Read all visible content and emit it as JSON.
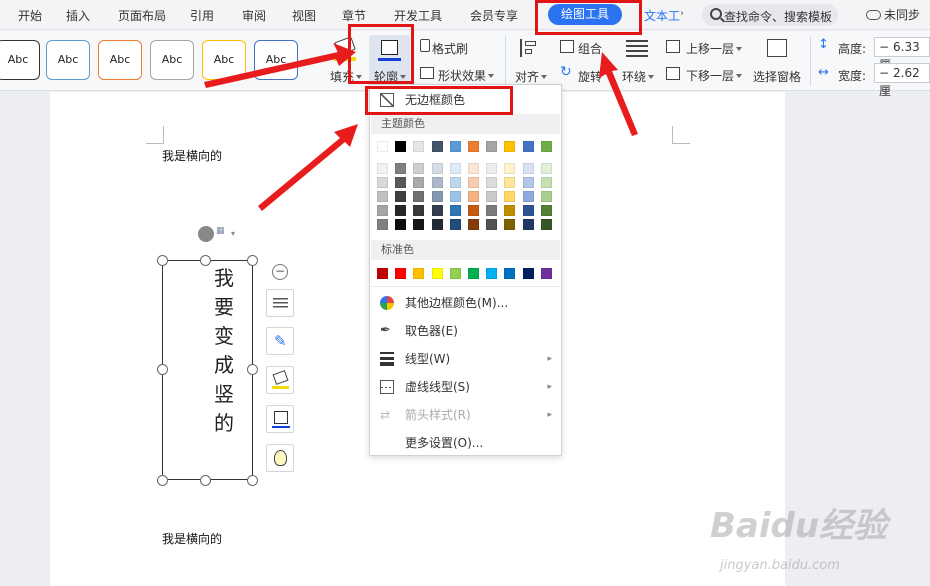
{
  "tabs": [
    "开始",
    "插入",
    "页面布局",
    "引用",
    "审阅",
    "视图",
    "章节",
    "开发工具",
    "会员专享"
  ],
  "active_tab": "绘图工具",
  "text_tool_tab": "文本工",
  "search_placeholder": "查找命令、搜索模板",
  "sync_label": "未同步",
  "styles": [
    "Abc",
    "Abc",
    "Abc",
    "Abc",
    "Abc",
    "Abc"
  ],
  "style_colors": [
    "#333333",
    "#5b9bd5",
    "#ed7d31",
    "#a5a5a5",
    "#ffc000",
    "#4472c4"
  ],
  "ribbon": {
    "fill": "填充",
    "outline": "轮廓",
    "format_brush": "格式刷",
    "shape_effect": "形状效果",
    "align": "对齐",
    "group": "组合",
    "rotate": "旋转",
    "wrap": "环绕",
    "bring_forward": "上移一层",
    "send_backward": "下移一层",
    "select_pane": "选择窗格",
    "height_label": "高度:",
    "height_value": "6.33厘",
    "width_label": "宽度:",
    "width_value": "2.62厘"
  },
  "document": {
    "text_top": "我是横向的",
    "vertical_chars": [
      "我",
      "要",
      "变",
      "成",
      "竖",
      "的"
    ],
    "text_bottom": "我是横向的"
  },
  "menu": {
    "no_border": "无边框颜色",
    "theme_colors": "主题颜色",
    "standard_colors": "标准色",
    "other_colors": "其他边框颜色(M)...",
    "eyedropper": "取色器(E)",
    "line_type": "线型(W)",
    "dash_type": "虚线线型(S)",
    "arrow_style": "箭头样式(R)",
    "more_settings": "更多设置(O)..."
  },
  "theme_top_row": [
    "#ffffff",
    "#000000",
    "#e7e6e6",
    "#44546a",
    "#5b9bd5",
    "#ed7d31",
    "#a5a5a5",
    "#ffc000",
    "#4472c4",
    "#70ad47"
  ],
  "theme_shades": [
    [
      "#f2f2f2",
      "#7f7f7f",
      "#d0cece",
      "#d6dce4",
      "#deebf6",
      "#fbe5d5",
      "#ededed",
      "#fff2cc",
      "#d9e2f3",
      "#e2efd9"
    ],
    [
      "#d8d8d8",
      "#595959",
      "#aeaaaa",
      "#adb9ca",
      "#bdd7ee",
      "#f7cbac",
      "#dbdbdb",
      "#fee599",
      "#b4c6e7",
      "#c5e0b3"
    ],
    [
      "#bfbfbf",
      "#3f3f3f",
      "#757070",
      "#8496b0",
      "#9cc3e5",
      "#f4b183",
      "#c9c9c9",
      "#ffd965",
      "#8eaadb",
      "#a8d08d"
    ],
    [
      "#a5a5a5",
      "#262626",
      "#3a3838",
      "#323f4f",
      "#2e75b5",
      "#c55a11",
      "#7b7b7b",
      "#bf8f00",
      "#2f5496",
      "#538135"
    ],
    [
      "#7f7f7f",
      "#0c0c0c",
      "#171616",
      "#222a35",
      "#1e4e79",
      "#843c0b",
      "#525252",
      "#7f6000",
      "#1f3864",
      "#375623"
    ]
  ],
  "standard_row": [
    "#c00000",
    "#ff0000",
    "#ffc000",
    "#ffff00",
    "#92d050",
    "#00b050",
    "#00b0f0",
    "#0070c0",
    "#002060",
    "#7030a0"
  ],
  "watermark": "Baidu经验",
  "watermark_url": "jingyan.baidu.com"
}
